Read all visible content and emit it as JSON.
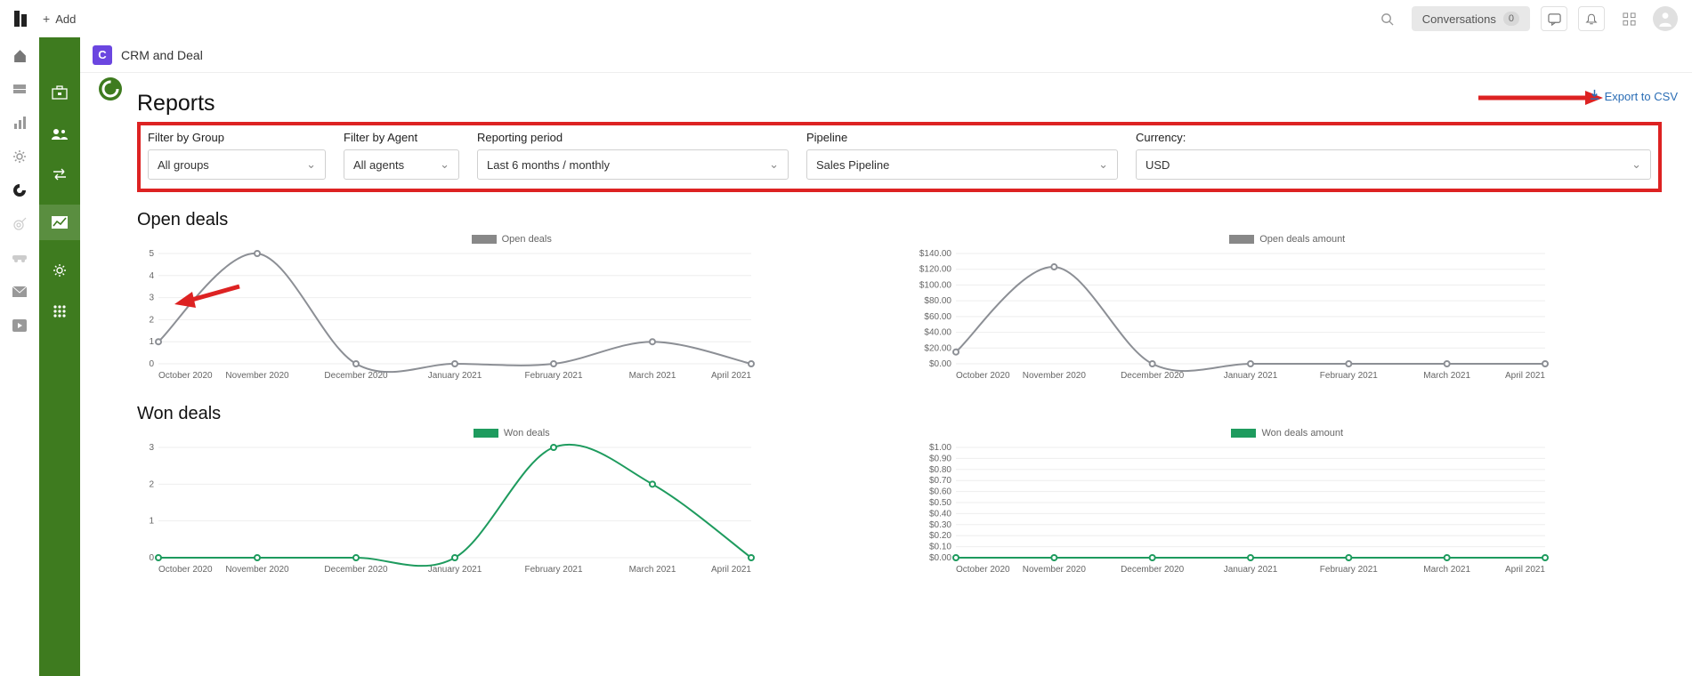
{
  "topbar": {
    "add_label": "Add",
    "conversations_label": "Conversations",
    "conversations_count": "0"
  },
  "breadcrumb": {
    "app_name": "CRM and Deal"
  },
  "page": {
    "title": "Reports",
    "export_label": "Export to CSV"
  },
  "filters": {
    "group_label": "Filter by Group",
    "group_value": "All groups",
    "agent_label": "Filter by Agent",
    "agent_value": "All agents",
    "period_label": "Reporting period",
    "period_value": "Last 6 months / monthly",
    "pipeline_label": "Pipeline",
    "pipeline_value": "Sales Pipeline",
    "currency_label": "Currency:",
    "currency_value": "USD"
  },
  "sections": {
    "open_deals": "Open deals",
    "won_deals": "Won deals"
  },
  "legends": {
    "open_deals": "Open deals",
    "open_amount": "Open deals amount",
    "won_deals": "Won deals",
    "won_amount": "Won deals amount"
  },
  "chart_data": [
    {
      "id": "open_deals_count",
      "type": "line",
      "title": "Open deals",
      "categories": [
        "October 2020",
        "November 2020",
        "December 2020",
        "January 2021",
        "February 2021",
        "March 2021",
        "April 2021"
      ],
      "values": [
        1,
        5,
        0,
        0,
        0,
        1,
        0
      ],
      "ylim": [
        0,
        5
      ],
      "yticks": [
        0,
        1,
        2,
        3,
        4,
        5
      ],
      "color": "#8c8f95"
    },
    {
      "id": "open_deals_amount",
      "type": "line",
      "title": "Open deals amount",
      "categories": [
        "October 2020",
        "November 2020",
        "December 2020",
        "January 2021",
        "February 2021",
        "March 2021",
        "April 2021"
      ],
      "values": [
        15,
        123,
        0,
        0,
        0,
        0,
        0
      ],
      "yticks_labels": [
        "$0.00",
        "$20.00",
        "$40.00",
        "$60.00",
        "$80.00",
        "$100.00",
        "$120.00",
        "$140.00"
      ],
      "ylim": [
        0,
        140
      ],
      "color": "#8c8f95"
    },
    {
      "id": "won_deals_count",
      "type": "line",
      "title": "Won deals",
      "categories": [
        "October 2020",
        "November 2020",
        "December 2020",
        "January 2021",
        "February 2021",
        "March 2021",
        "April 2021"
      ],
      "values": [
        0,
        0,
        0,
        0,
        3,
        2,
        0
      ],
      "ylim": [
        0,
        3
      ],
      "yticks": [
        0,
        1,
        2,
        3
      ],
      "color": "#1e9b5e"
    },
    {
      "id": "won_deals_amount",
      "type": "line",
      "title": "Won deals amount",
      "categories": [
        "October 2020",
        "November 2020",
        "December 2020",
        "January 2021",
        "February 2021",
        "March 2021",
        "April 2021"
      ],
      "values": [
        0,
        0,
        0,
        0,
        0,
        0,
        0
      ],
      "yticks_labels": [
        "$0.00",
        "$0.10",
        "$0.20",
        "$0.30",
        "$0.40",
        "$0.50",
        "$0.60",
        "$0.70",
        "$0.80",
        "$0.90",
        "$1.00"
      ],
      "ylim": [
        0,
        1
      ],
      "color": "#1e9b5e"
    }
  ]
}
